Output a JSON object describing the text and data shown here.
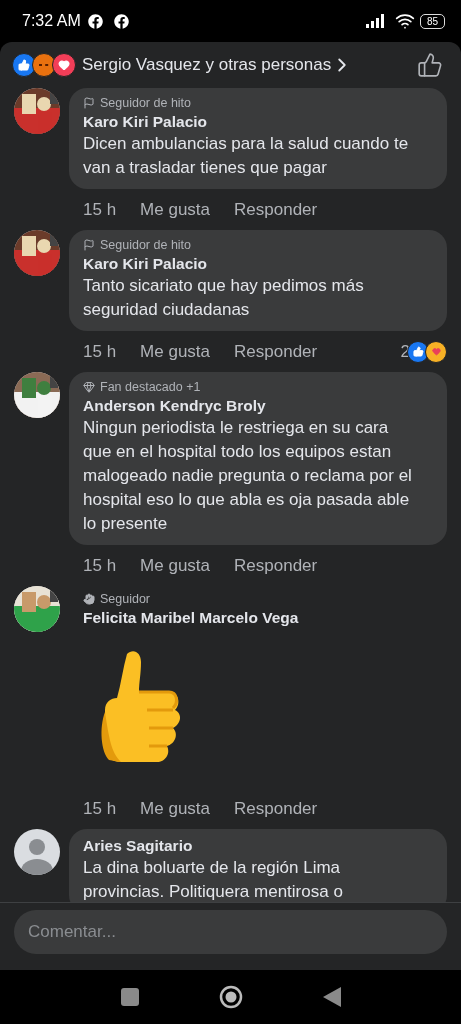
{
  "status_bar": {
    "time": "7:32 AM",
    "battery": "85"
  },
  "reactions_header": {
    "reactions": [
      {
        "kind": "like"
      },
      {
        "kind": "angry"
      },
      {
        "kind": "love"
      }
    ],
    "text": "Sergio Vasquez y otras personas"
  },
  "comments": [
    {
      "avatar": {
        "kind": "picture"
      },
      "badge": {
        "kind": "flag",
        "text": "Seguidor de hito"
      },
      "name": "Karo Kiri Palacio",
      "kind": "text",
      "text": "Dicen ambulancias para la salud cuando te van a trasladar tienes que pagar",
      "time": "15 h",
      "like": "Me gusta",
      "reply": "Responder"
    },
    {
      "avatar": {
        "kind": "picture"
      },
      "badge": {
        "kind": "flag",
        "text": "Seguidor de hito"
      },
      "name": "Karo Kiri Palacio",
      "kind": "text",
      "text": "Tanto sicariato que hay pedimos más seguridad  ciudadanas",
      "time": "15 h",
      "like": "Me gusta",
      "reply": "Responder",
      "reaction_count": "2",
      "reactions": [
        {
          "kind": "like"
        },
        {
          "kind": "care"
        }
      ]
    },
    {
      "avatar": {
        "kind": "picture"
      },
      "badge": {
        "kind": "diamond",
        "text": "Fan destacado +1"
      },
      "name": "Anderson Kendryc Broly",
      "kind": "text",
      "text": "Ningun periodista le restriega en su cara que en el hospital todo los equipos estan malogeado nadie pregunta o reclama por el hospital eso lo que abla es oja pasada able lo presente",
      "time": "15 h",
      "like": "Me gusta",
      "reply": "Responder"
    },
    {
      "avatar": {
        "kind": "picture"
      },
      "badge": {
        "kind": "wave",
        "text": "Seguidor"
      },
      "name": "Felicita Maribel Marcelo Vega",
      "kind": "sticker",
      "time": "15 h",
      "like": "Me gusta",
      "reply": "Responder"
    },
    {
      "avatar": {
        "kind": "default"
      },
      "name": "Aries Sagitario",
      "kind": "text",
      "text": "La dina boluarte de la región Lima provincias. Politiquera mentirosa o"
    }
  ],
  "composer": {
    "placeholder": "Comentar..."
  }
}
